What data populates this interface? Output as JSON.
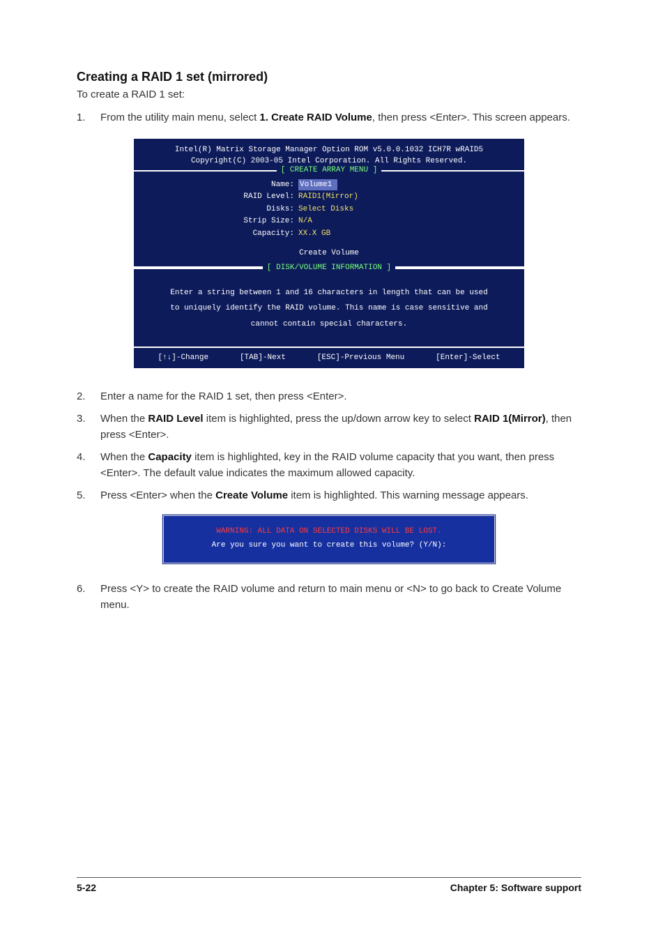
{
  "heading": "Creating a RAID 1 set (mirrored)",
  "intro": "To create a RAID 1 set:",
  "steps": {
    "s1": {
      "num": "1.",
      "pre": "From the utility main menu, select ",
      "bold": "1. Create RAID Volume",
      "post": ", then press <Enter>. This screen appears."
    },
    "s2": {
      "num": "2.",
      "text": "Enter a name for the RAID 1 set, then press <Enter>."
    },
    "s3": {
      "num": "3.",
      "pre": "When the ",
      "b1": "RAID Level",
      "mid": " item is highlighted, press the up/down arrow key to select ",
      "b2": "RAID 1(Mirror)",
      "post": ", then press <Enter>."
    },
    "s4": {
      "num": "4.",
      "pre": "When the ",
      "b1": "Capacity",
      "post": " item is highlighted, key in the RAID volume capacity that you want, then press <Enter>. The default value indicates the maximum allowed capacity."
    },
    "s5": {
      "num": "5.",
      "pre": "Press <Enter> when the ",
      "b1": "Create Volume",
      "post": " item is highlighted. This warning message appears."
    },
    "s6": {
      "num": "6.",
      "text": "Press <Y> to create the RAID volume and return to main menu or <N> to go back to Create Volume menu."
    }
  },
  "term": {
    "h1": "Intel(R) Matrix Storage Manager Option ROM v5.0.0.1032 ICH7R wRAID5",
    "h2": "Copyright(C) 2003-05 Intel Corporation. All Rights Reserved.",
    "frame_title": "[ CREATE ARRAY MENU ]",
    "fields": {
      "name_l": "Name:",
      "name_v": "Volume1",
      "level_l": "RAID Level:",
      "level_v": "RAID1(Mirror)",
      "disks_l": "Disks:",
      "disks_v": "Select Disks",
      "strip_l": "Strip Size:",
      "strip_v": "N/A",
      "cap_l": "Capacity:",
      "cap_v": "XX.X  GB"
    },
    "create": "Create Volume",
    "info_title": "[ DISK/VOLUME INFORMATION ]",
    "info1": "Enter a string between 1 and 16 characters in length that can be used",
    "info2": "to uniquely identify the RAID volume. This name is case sensitive and",
    "info3": "cannot contain special characters.",
    "f1": "[↑↓]-Change",
    "f2": "[TAB]-Next",
    "f3": "[ESC]-Previous Menu",
    "f4": "[Enter]-Select"
  },
  "warn": {
    "l1": "WARNING: ALL DATA ON SELECTED DISKS WILL BE LOST.",
    "l2": "Are you sure you want to create this volume? (Y/N):"
  },
  "footer": {
    "left": "5-22",
    "right": "Chapter 5: Software support"
  }
}
